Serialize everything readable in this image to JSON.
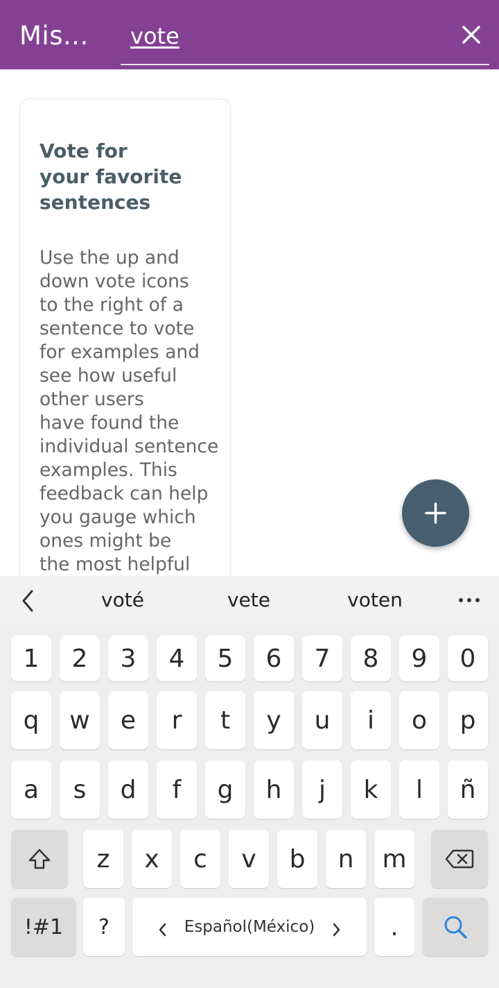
{
  "header": {
    "app_title": "Mis...",
    "search_value": "vote",
    "close_icon": "close-icon"
  },
  "card": {
    "title_line1": "Vote for",
    "title_line2": "your favorite",
    "title_line3": "sentences",
    "body_lines": [
      "Use the up and",
      "down vote icons",
      "to the right of a",
      "sentence to vote",
      "for examples and",
      "see how useful",
      "other users",
      "have found the",
      "individual sentence",
      "examples. This",
      "feedback can help",
      "you gauge which",
      "ones might be",
      "the most helpful"
    ]
  },
  "fab": {
    "icon": "plus-icon"
  },
  "keyboard": {
    "suggestions": [
      "voté",
      "vete",
      "voten"
    ],
    "more_icon": "more-icon",
    "back_icon": "chevron-left-icon",
    "row_numbers": [
      "1",
      "2",
      "3",
      "4",
      "5",
      "6",
      "7",
      "8",
      "9",
      "0"
    ],
    "row1": [
      "q",
      "w",
      "e",
      "r",
      "t",
      "y",
      "u",
      "i",
      "o",
      "p"
    ],
    "row2": [
      "a",
      "s",
      "d",
      "f",
      "g",
      "h",
      "j",
      "k",
      "l",
      "ñ"
    ],
    "row3": [
      "z",
      "x",
      "c",
      "v",
      "b",
      "n",
      "m"
    ],
    "symbols_label": "!#1",
    "question_label": "?",
    "language_label": "Español(México)",
    "period_label": ".",
    "search_icon": "search-icon",
    "shift_icon": "shift-icon",
    "backspace_icon": "backspace-icon",
    "accent_color": "#2f86d6"
  }
}
